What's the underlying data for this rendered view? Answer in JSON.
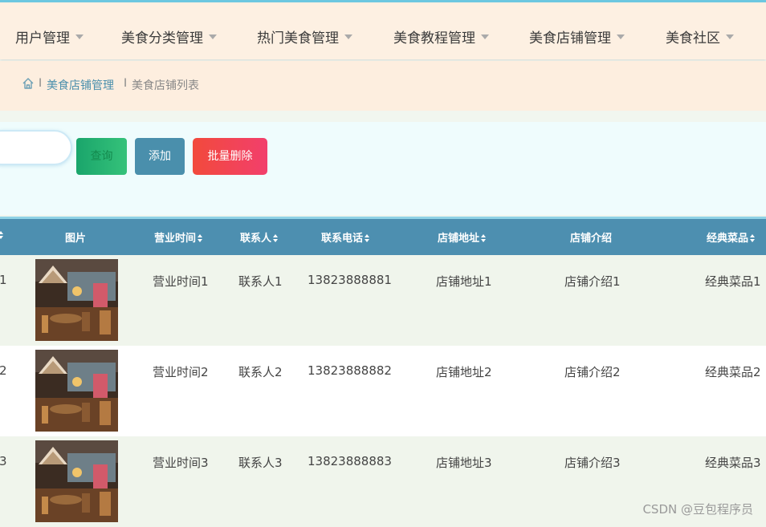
{
  "nav": {
    "items": [
      {
        "label": "用户管理"
      },
      {
        "label": "美食分类管理"
      },
      {
        "label": "热门美食管理"
      },
      {
        "label": "美食教程管理"
      },
      {
        "label": "美食店铺管理"
      },
      {
        "label": "美食社区"
      }
    ]
  },
  "breadcrumb": {
    "separator": "I",
    "items": [
      "美食店铺管理",
      "美食店铺列表"
    ]
  },
  "search": {
    "placeholder": "",
    "query_label": "查询",
    "add_label": "添加",
    "batch_delete_label": "批量删除"
  },
  "table": {
    "columns": [
      "图片",
      "营业时间",
      "联系人",
      "联系电话",
      "店铺地址",
      "店铺介绍",
      "经典菜品"
    ],
    "rows": [
      {
        "index": "1",
        "hours": "营业时间1",
        "contact": "联系人1",
        "phone": "13823888881",
        "address": "店铺地址1",
        "intro": "店铺介绍1",
        "dish": "经典菜品1"
      },
      {
        "index": "2",
        "hours": "营业时间2",
        "contact": "联系人2",
        "phone": "13823888882",
        "address": "店铺地址2",
        "intro": "店铺介绍2",
        "dish": "经典菜品2"
      },
      {
        "index": "3",
        "hours": "营业时间3",
        "contact": "联系人3",
        "phone": "13823888883",
        "address": "店铺地址3",
        "intro": "店铺介绍3",
        "dish": "经典菜品3"
      }
    ]
  },
  "watermark": "CSDN @豆包程序员",
  "colors": {
    "nav_bg": "#fdf0e2",
    "header_bg": "#4d8fb0",
    "add_button": "#4a8fac",
    "delete_button": "#f24a3c",
    "query_button": "#1aa56b",
    "breadcrumb_link": "#4a8fac"
  }
}
